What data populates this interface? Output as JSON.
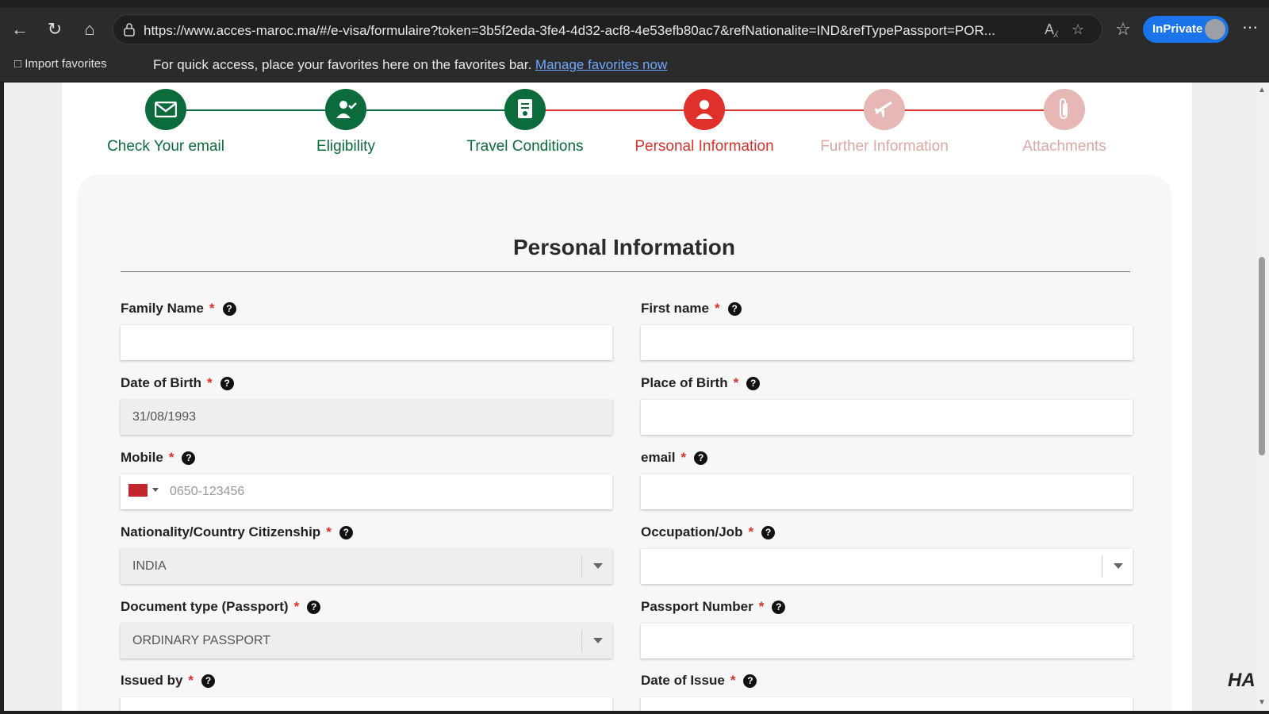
{
  "browser": {
    "url": "https://www.acces-maroc.ma/#/e-visa/formulaire?token=3b5f2eda-3fe4-4d32-acf8-4e53efb80ac7&refNationalite=IND&refTypePassport=POR...",
    "inprivate_label": "InPrivate",
    "import_favorites": "Import favorites",
    "favbar_message": "For quick access, place your favorites here on the favorites bar.",
    "favbar_link": "Manage favorites now"
  },
  "stepper": {
    "steps": [
      {
        "label": "Check Your email",
        "state": "done",
        "icon": "envelope-icon"
      },
      {
        "label": "Eligibility",
        "state": "done",
        "icon": "user-check-icon"
      },
      {
        "label": "Travel Conditions",
        "state": "done",
        "icon": "document-shield-icon"
      },
      {
        "label": "Personal Information",
        "state": "active",
        "icon": "person-icon"
      },
      {
        "label": "Further Information",
        "state": "pending",
        "icon": "plane-icon"
      },
      {
        "label": "Attachments",
        "state": "pending",
        "icon": "paperclip-icon"
      }
    ],
    "colors": {
      "done": "#0b6b3a",
      "active": "#e0302c",
      "pending": "#e6b7b5"
    }
  },
  "form": {
    "title": "Personal Information",
    "required_mark": "*",
    "help_glyph": "?",
    "fields": {
      "family_name": {
        "label": "Family Name",
        "value": ""
      },
      "first_name": {
        "label": "First name",
        "value": ""
      },
      "date_of_birth": {
        "label": "Date of Birth",
        "value": "31/08/1993"
      },
      "place_of_birth": {
        "label": "Place of Birth",
        "value": ""
      },
      "mobile": {
        "label": "Mobile",
        "placeholder": "0650-123456"
      },
      "email": {
        "label": "email",
        "value": ""
      },
      "nationality": {
        "label": "Nationality/Country Citizenship",
        "value": "INDIA"
      },
      "occupation": {
        "label": "Occupation/Job",
        "value": ""
      },
      "document_type": {
        "label": "Document type (Passport)",
        "value": "ORDINARY PASSPORT"
      },
      "passport_number": {
        "label": "Passport Number",
        "value": ""
      },
      "issued_by": {
        "label": "Issued by",
        "value": ""
      },
      "date_of_issue": {
        "label": "Date of Issue",
        "value": ""
      }
    }
  },
  "watermark": "HA"
}
